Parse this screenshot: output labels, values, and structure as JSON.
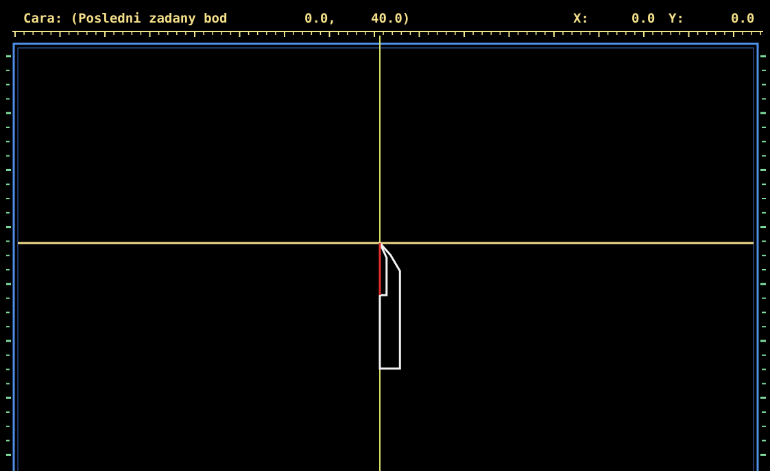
{
  "status_bar": {
    "prompt_label": "Cara: (Posledni zadany bod",
    "last_point_x": "0.0,",
    "last_point_y": "40.0)",
    "cursor_x_label": "X:",
    "cursor_x_value": "0.0",
    "cursor_y_label": "Y:",
    "cursor_y_value": "0.0"
  },
  "colors": {
    "background": "#000000",
    "status_text": "#f4e08a",
    "ruler": "#f0e68c",
    "frame": "#4f8fe8",
    "tick_marks": "#7fdc9e",
    "axis_vertical": "#d7e26a",
    "axis_horizontal": "#f3dc8c",
    "contour": "#f2f2f2",
    "active_segment": "#e23030"
  },
  "drawing": {
    "contour_points": [
      [
        0,
        0
      ],
      [
        0.8,
        -0.9
      ],
      [
        1.5,
        -2.1
      ],
      [
        1.5,
        -9.4
      ],
      [
        0,
        -9.4
      ],
      [
        0,
        -3.9
      ],
      [
        0.5,
        -3.9
      ],
      [
        0.5,
        -1.1
      ]
    ],
    "active_segment": [
      [
        0,
        0
      ],
      [
        0,
        -3.9
      ]
    ]
  }
}
